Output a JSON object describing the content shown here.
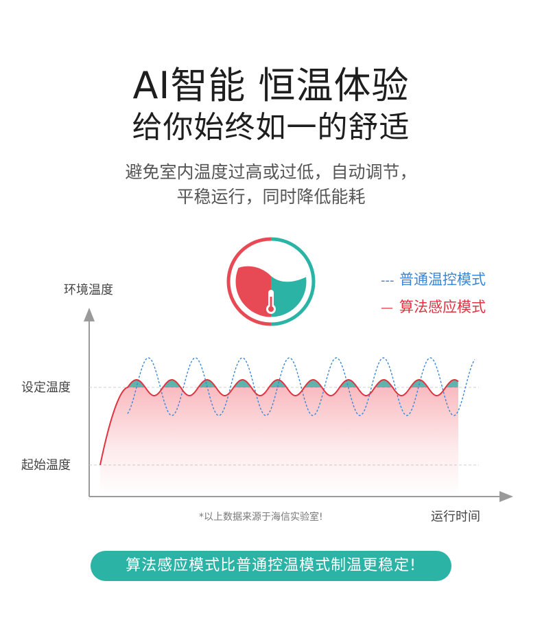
{
  "header": {
    "title_line1": "AI智能 恒温体验",
    "title_line2": "给你始终如一的舒适",
    "subtitle_line1": "避免室内温度过高或过低，自动调节，",
    "subtitle_line2": "平稳运行，同时降低能耗"
  },
  "icon": {
    "name": "thermometer-icon",
    "left_color": "#e84a55",
    "right_color": "#2bb3a6"
  },
  "chart_data": {
    "type": "line",
    "ylabel": "环境温度",
    "xlabel": "运行时间",
    "y_ticks": [
      "设定温度",
      "起始温度"
    ],
    "footnote": "*以上数据来源于海信实验室!",
    "series": [
      {
        "name": "普通温控模式",
        "style": "dashed",
        "color": "#3a86d6",
        "legend_prefix": "---"
      },
      {
        "name": "算法感应模式",
        "style": "solid",
        "color": "#e1323f",
        "legend_prefix": "—"
      }
    ],
    "colors": {
      "fill_red": "#f05a66",
      "fill_teal": "#2bb3a6",
      "axis": "#9a9a9a"
    },
    "grid": "dashed reference lines at 设定温度 and 起始温度",
    "legend": "top-right"
  },
  "footer": {
    "banner": "算法感应模式比普通控温模式制温更稳定!"
  }
}
